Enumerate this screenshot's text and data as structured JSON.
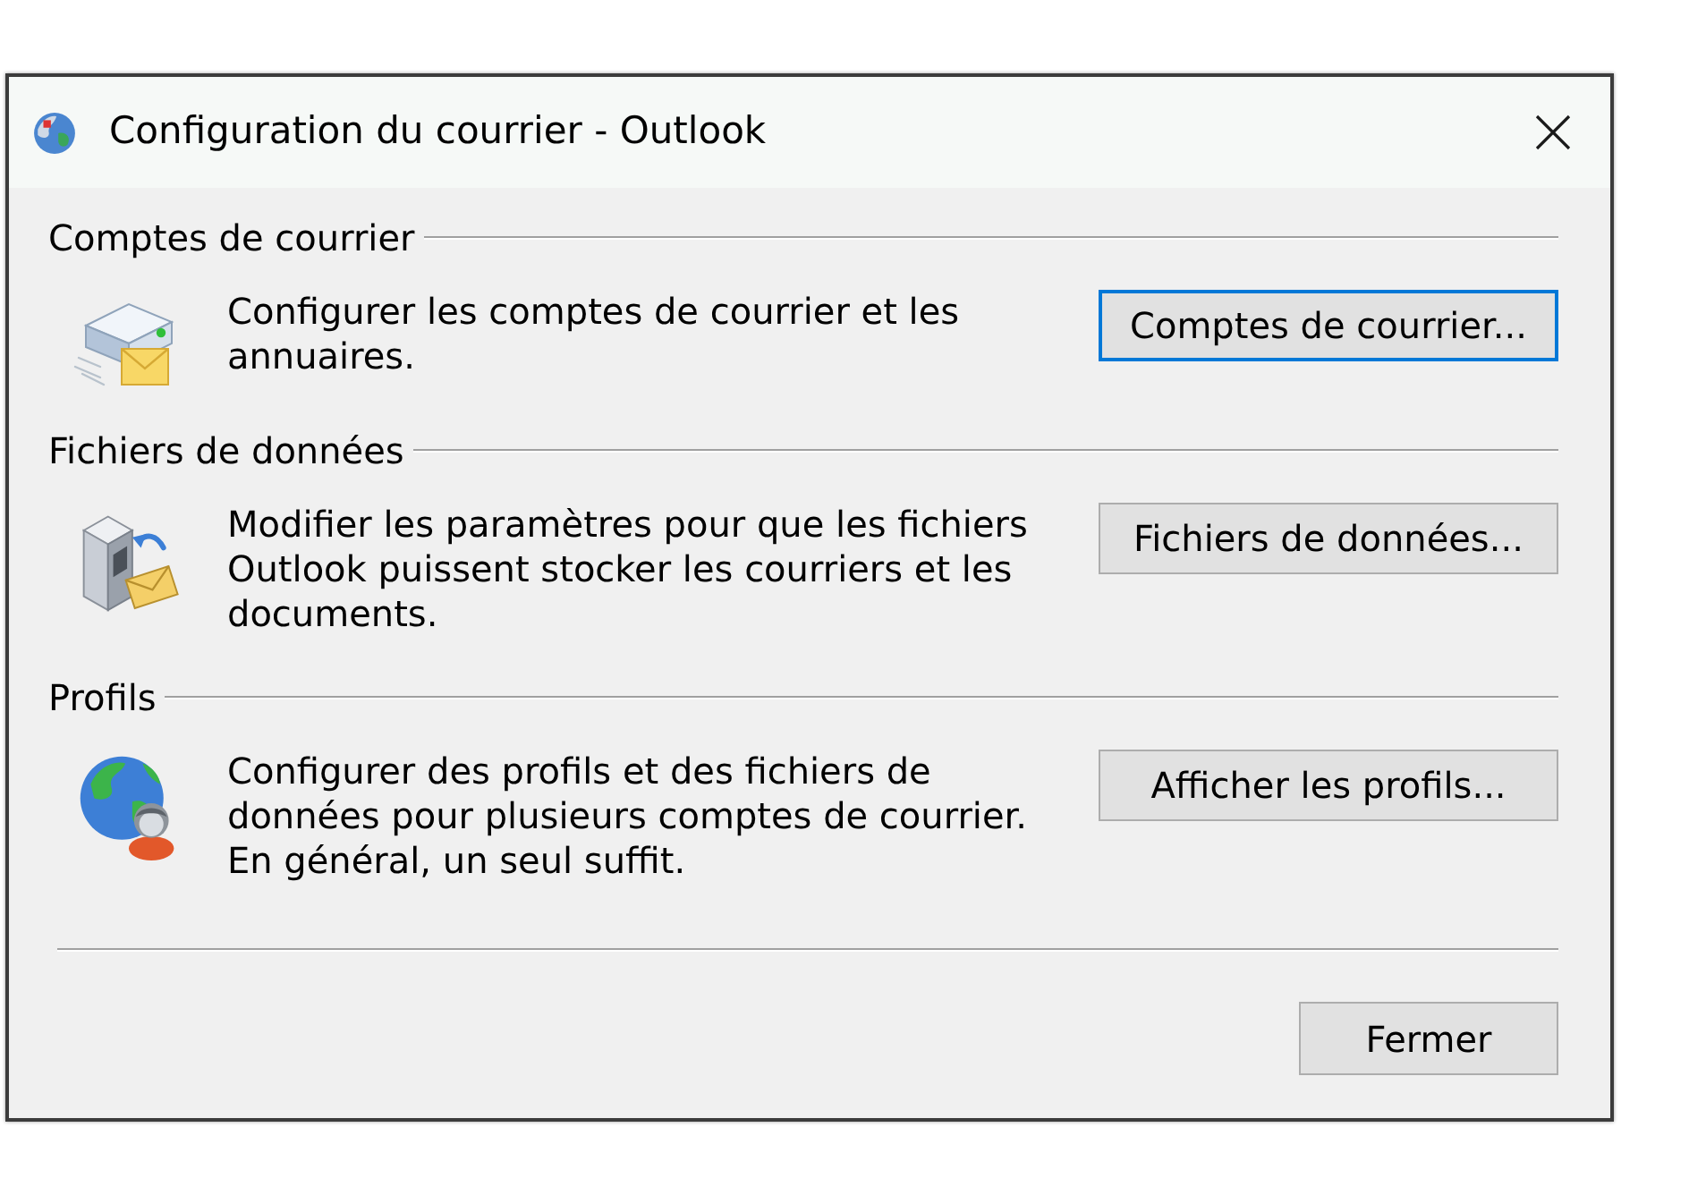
{
  "window": {
    "title": "Configuration du courrier - Outlook"
  },
  "sections": [
    {
      "kind": "accounts",
      "heading": "Comptes de courrier",
      "description": "Configurer les comptes de courrier et les annuaires.",
      "button": {
        "label": "Comptes de courrier...",
        "focused": true
      }
    },
    {
      "kind": "data_files",
      "heading": "Fichiers de données",
      "description": "Modifier les paramètres pour que les fichiers Outlook puissent stocker les courriers et les documents.",
      "button": {
        "label": "Fichiers de données...",
        "focused": false
      }
    },
    {
      "kind": "profiles",
      "heading": "Profils",
      "description": "Configurer des profils et des fichiers de données pour plusieurs comptes de courrier. En général, un seul suffit.",
      "button": {
        "label": "Afficher les profils...",
        "focused": false
      }
    }
  ],
  "close_button": {
    "label": "Fermer",
    "focused": false
  }
}
